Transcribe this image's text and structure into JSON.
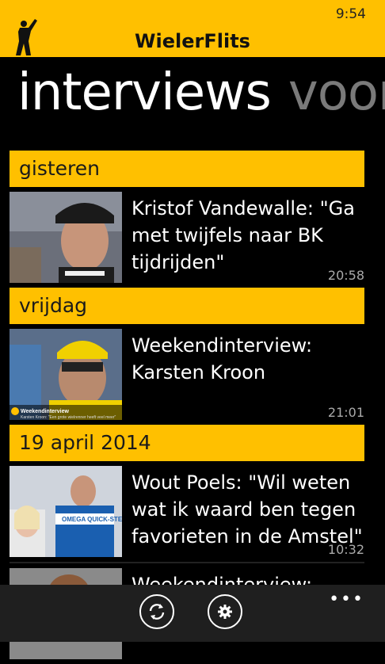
{
  "status_bar": {
    "time": "9:54"
  },
  "app": {
    "title": "WielerFlits"
  },
  "pivot": {
    "active": "interviews",
    "next": "voor"
  },
  "groups": [
    {
      "header": "gisteren",
      "articles": [
        {
          "title": "Kristof Vandewalle: \"Ga met twijfels naar BK tijdrijden\"",
          "time": "20:58"
        }
      ]
    },
    {
      "header": "vrijdag",
      "articles": [
        {
          "title": "Weekendinterview: Karsten Kroon",
          "time": "21:01",
          "thumb_caption": "Weekendinterview",
          "thumb_subcaption": "Karsten Kroon: \"Een grote wielrenner heeft veel meer\""
        }
      ]
    },
    {
      "header": "19 april 2014",
      "articles": [
        {
          "title": "Wout Poels: \"Wil weten wat ik waard ben tegen favorieten in de Amstel\"",
          "time": "10:32",
          "thumb_caption": "OMEGA QUICK-STEP"
        },
        {
          "title": "Weekendinterview:",
          "time": ""
        }
      ]
    }
  ],
  "app_bar": {
    "refresh_icon": "refresh-icon",
    "settings_icon": "gear-icon",
    "more": "•••"
  },
  "colors": {
    "accent": "#ffc000",
    "background": "#000000",
    "appbar": "#1f1f1f"
  }
}
